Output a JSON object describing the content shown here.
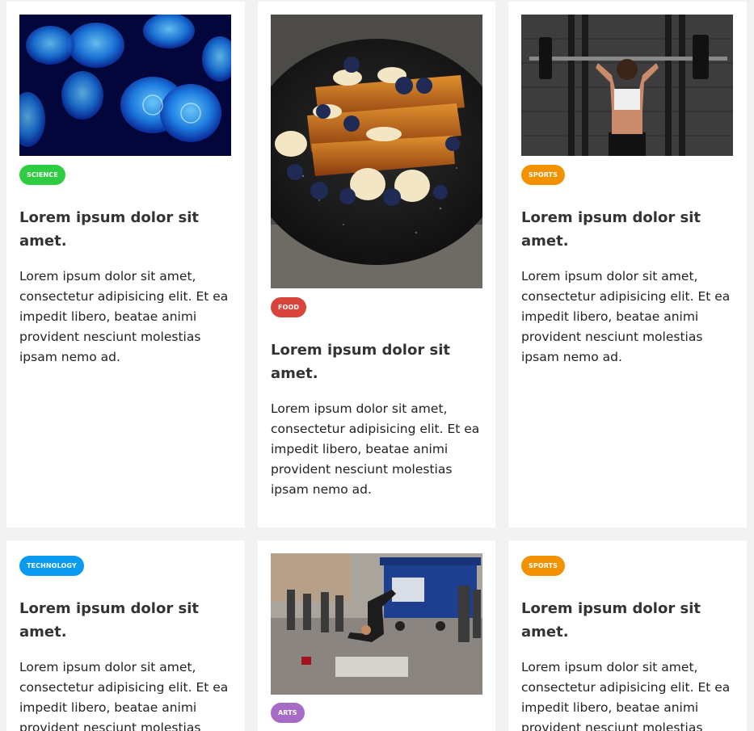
{
  "cards": [
    {
      "image": "jellyfish-photo",
      "tag": "SCIENCE",
      "tag_color": "#2ecc40",
      "title": "Lorem ipsum dolor sit amet.",
      "text": "Lorem ipsum dolor sit amet, consectetur adipisicing elit. Et ea impedit libero, beatae animi provident nesciunt molestias ipsam nemo ad."
    },
    {
      "image": "french-toast-photo",
      "tag": "FOOD",
      "tag_color": "#d9443a",
      "title": "Lorem ipsum dolor sit amet.",
      "text": "Lorem ipsum dolor sit amet, consectetur adipisicing elit. Et ea impedit libero, beatae animi provident nesciunt molestias ipsam nemo ad."
    },
    {
      "image": "weightlifting-photo",
      "tag": "SPORTS",
      "tag_color": "#f39200",
      "title": "Lorem ipsum dolor sit amet.",
      "text": "Lorem ipsum dolor sit amet, consectetur adipisicing elit. Et ea impedit libero, beatae animi provident nesciunt molestias ipsam nemo ad."
    },
    {
      "image": null,
      "tag": "TECHNOLOGY",
      "tag_color": "#0a9af0",
      "title": "Lorem ipsum dolor sit amet.",
      "text": "Lorem ipsum dolor sit amet, consectetur adipisicing elit. Et ea impedit libero, beatae animi provident nesciunt molestias ipsam nemo ad."
    },
    {
      "image": "breakdancer-photo",
      "tag": "ARTS",
      "tag_color": "#a66bc7"
    },
    {
      "image": null,
      "tag": "SPORTS",
      "tag_color": "#f39200",
      "title": "Lorem ipsum dolor sit amet.",
      "text": "Lorem ipsum dolor sit amet, consectetur adipisicing elit. Et ea impedit libero, beatae animi provident nesciunt molestias ipsam nemo ad."
    }
  ]
}
